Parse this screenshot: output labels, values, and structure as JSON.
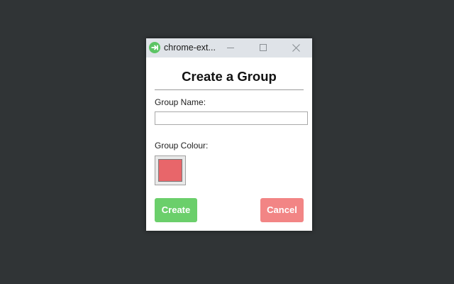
{
  "window": {
    "title": "chrome-ext...",
    "app_icon": "extension-arrow-icon",
    "controls": {
      "minimize_icon": "minimize-icon",
      "maximize_icon": "maximize-icon",
      "close_icon": "close-icon"
    }
  },
  "dialog": {
    "heading": "Create a Group",
    "name_label": "Group Name:",
    "name_value": "",
    "colour_label": "Group Colour:",
    "selected_colour": "#e8666a",
    "create_label": "Create",
    "cancel_label": "Cancel"
  },
  "colors": {
    "create_button": "#6bcf6b",
    "cancel_button": "#f28585",
    "titlebar": "#dfe3e8",
    "desktop": "#303436"
  }
}
